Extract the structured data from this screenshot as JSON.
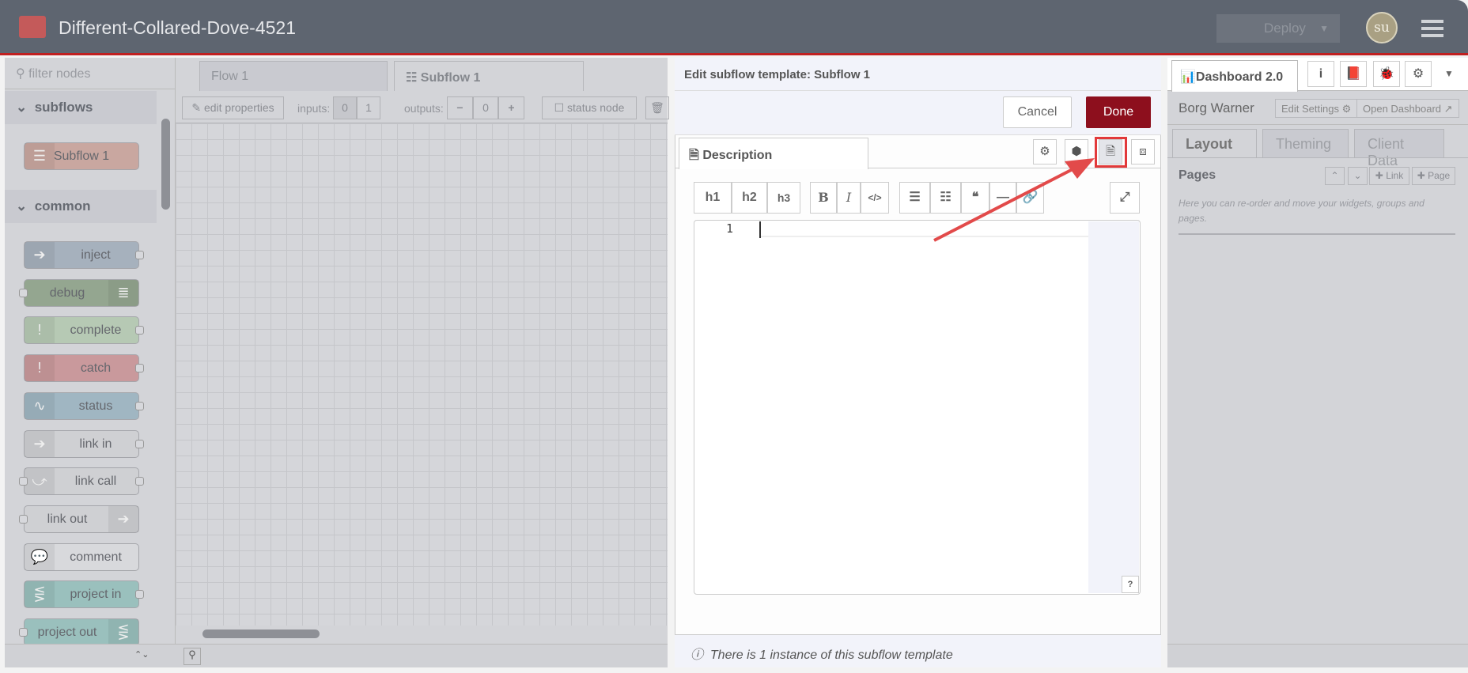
{
  "header": {
    "title": "Different-Collared-Dove-4521",
    "deploy_label": "Deploy",
    "avatar": "su"
  },
  "palette": {
    "filter_placeholder": "filter nodes",
    "categories": [
      {
        "label": "subflows"
      },
      {
        "label": "common"
      }
    ],
    "subflow_nodes": [
      {
        "label": "Subflow 1",
        "color": "#c9a7a0"
      }
    ],
    "common_nodes": [
      {
        "label": "inject",
        "color": "#a6b1bd",
        "icon": "arrow-right-icon"
      },
      {
        "label": "debug",
        "color": "#94a690",
        "icon": "list-icon"
      },
      {
        "label": "complete",
        "color": "#b6c9b4",
        "icon": "exclamation-icon"
      },
      {
        "label": "catch",
        "color": "#c9999c",
        "icon": "exclamation-icon"
      },
      {
        "label": "status",
        "color": "#a0b6c2",
        "icon": "pulse-icon"
      },
      {
        "label": "link in",
        "color": "#cfd0d3",
        "icon": "link-in-icon"
      },
      {
        "label": "link call",
        "color": "#cfd0d3",
        "icon": "link-call-icon"
      },
      {
        "label": "link out",
        "color": "#cfd0d3",
        "icon": "link-out-icon"
      },
      {
        "label": "comment",
        "color": "#d8d9dc",
        "icon": "comment-icon"
      },
      {
        "label": "project in",
        "color": "#9ac0bd",
        "icon": "project-icon"
      },
      {
        "label": "project out",
        "color": "#9ac0bd",
        "icon": "project-icon"
      }
    ]
  },
  "workspace": {
    "tabs": [
      {
        "label": "Flow 1"
      },
      {
        "label": "Subflow 1"
      }
    ],
    "toolbar": {
      "edit_properties": "edit properties",
      "inputs_label": "inputs:",
      "input_options": [
        "0",
        "1"
      ],
      "outputs_label": "outputs:",
      "outputs_value": "0",
      "status_node": "status node"
    }
  },
  "editor": {
    "title": "Edit subflow template: Subflow 1",
    "cancel": "Cancel",
    "done": "Done",
    "tab": "Description",
    "format_buttons": {
      "h1": "h1",
      "h2": "h2",
      "h3": "h3",
      "bold": "B",
      "italic": "I"
    },
    "line_number": "1",
    "help": "?",
    "info": "There is 1 instance of this subflow template",
    "annotation_color": "#e2393a"
  },
  "sidebar": {
    "tab": "Dashboard 2.0",
    "dashboard_name": "Borg Warner",
    "edit_settings": "Edit Settings",
    "open_dashboard": "Open Dashboard",
    "tabs": [
      {
        "label": "Layout"
      },
      {
        "label": "Theming"
      },
      {
        "label": "Client Data"
      }
    ],
    "pages_title": "Pages",
    "link_button": "Link",
    "page_button": "Page",
    "pages_help": "Here you can re-order and move your widgets, groups and pages."
  }
}
